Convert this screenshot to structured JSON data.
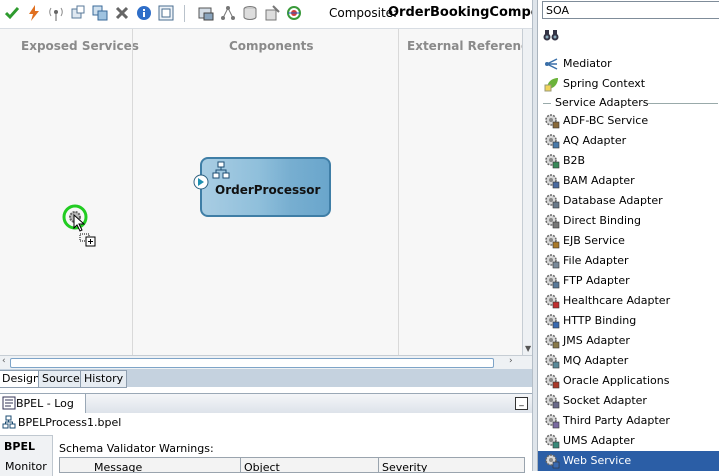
{
  "toolbar": {
    "composite_label": "Composite:",
    "composite_name": "OrderBookingComposite",
    "icons": [
      "validate-check-icon",
      "bolt-icon",
      "antenna-icon",
      "component-add-icon",
      "component-group-icon",
      "delete-x-icon",
      "info-icon",
      "layout-icon",
      "deploy-icon",
      "network-icon",
      "stack-icon",
      "wizard-icon",
      "color-wheel-icon"
    ]
  },
  "canvas": {
    "lane_exposed": "Exposed Services",
    "lane_components": "Components",
    "lane_external": "External References",
    "component_name": "OrderProcessor"
  },
  "view_tabs": [
    "Design",
    "Source",
    "History"
  ],
  "log": {
    "tab_title": "BPEL - Log",
    "file_name": "BPELProcess1.bpel",
    "side_tab_1": "BPEL",
    "side_tab_2": "Monitor",
    "warnings_label": "Schema Validator Warnings:",
    "columns": [
      "Message",
      "Object",
      "Severity"
    ]
  },
  "palette": {
    "selected_category": "SOA",
    "section_label": "Service Adapters",
    "top_items": [
      {
        "label": "Mediator",
        "icon": "mediator-icon"
      },
      {
        "label": "Spring Context",
        "icon": "spring-icon"
      }
    ],
    "items": [
      {
        "label": "ADF-BC Service",
        "icon": "adf-bc-icon"
      },
      {
        "label": "AQ Adapter",
        "icon": "aq-adapter-icon"
      },
      {
        "label": "B2B",
        "icon": "b2b-icon"
      },
      {
        "label": "BAM Adapter",
        "icon": "bam-adapter-icon"
      },
      {
        "label": "Database Adapter",
        "icon": "database-adapter-icon"
      },
      {
        "label": "Direct Binding",
        "icon": "direct-binding-icon"
      },
      {
        "label": "EJB Service",
        "icon": "ejb-service-icon"
      },
      {
        "label": "File Adapter",
        "icon": "file-adapter-icon"
      },
      {
        "label": "FTP Adapter",
        "icon": "ftp-adapter-icon"
      },
      {
        "label": "Healthcare Adapter",
        "icon": "healthcare-adapter-icon"
      },
      {
        "label": "HTTP Binding",
        "icon": "http-binding-icon"
      },
      {
        "label": "JMS Adapter",
        "icon": "jms-adapter-icon"
      },
      {
        "label": "MQ Adapter",
        "icon": "mq-adapter-icon"
      },
      {
        "label": "Oracle Applications",
        "icon": "oracle-apps-icon"
      },
      {
        "label": "Socket Adapter",
        "icon": "socket-adapter-icon"
      },
      {
        "label": "Third Party Adapter",
        "icon": "third-party-adapter-icon"
      },
      {
        "label": "UMS Adapter",
        "icon": "ums-adapter-icon"
      },
      {
        "label": "Web Service",
        "icon": "web-service-icon"
      }
    ],
    "selected_item": "Web Service"
  }
}
